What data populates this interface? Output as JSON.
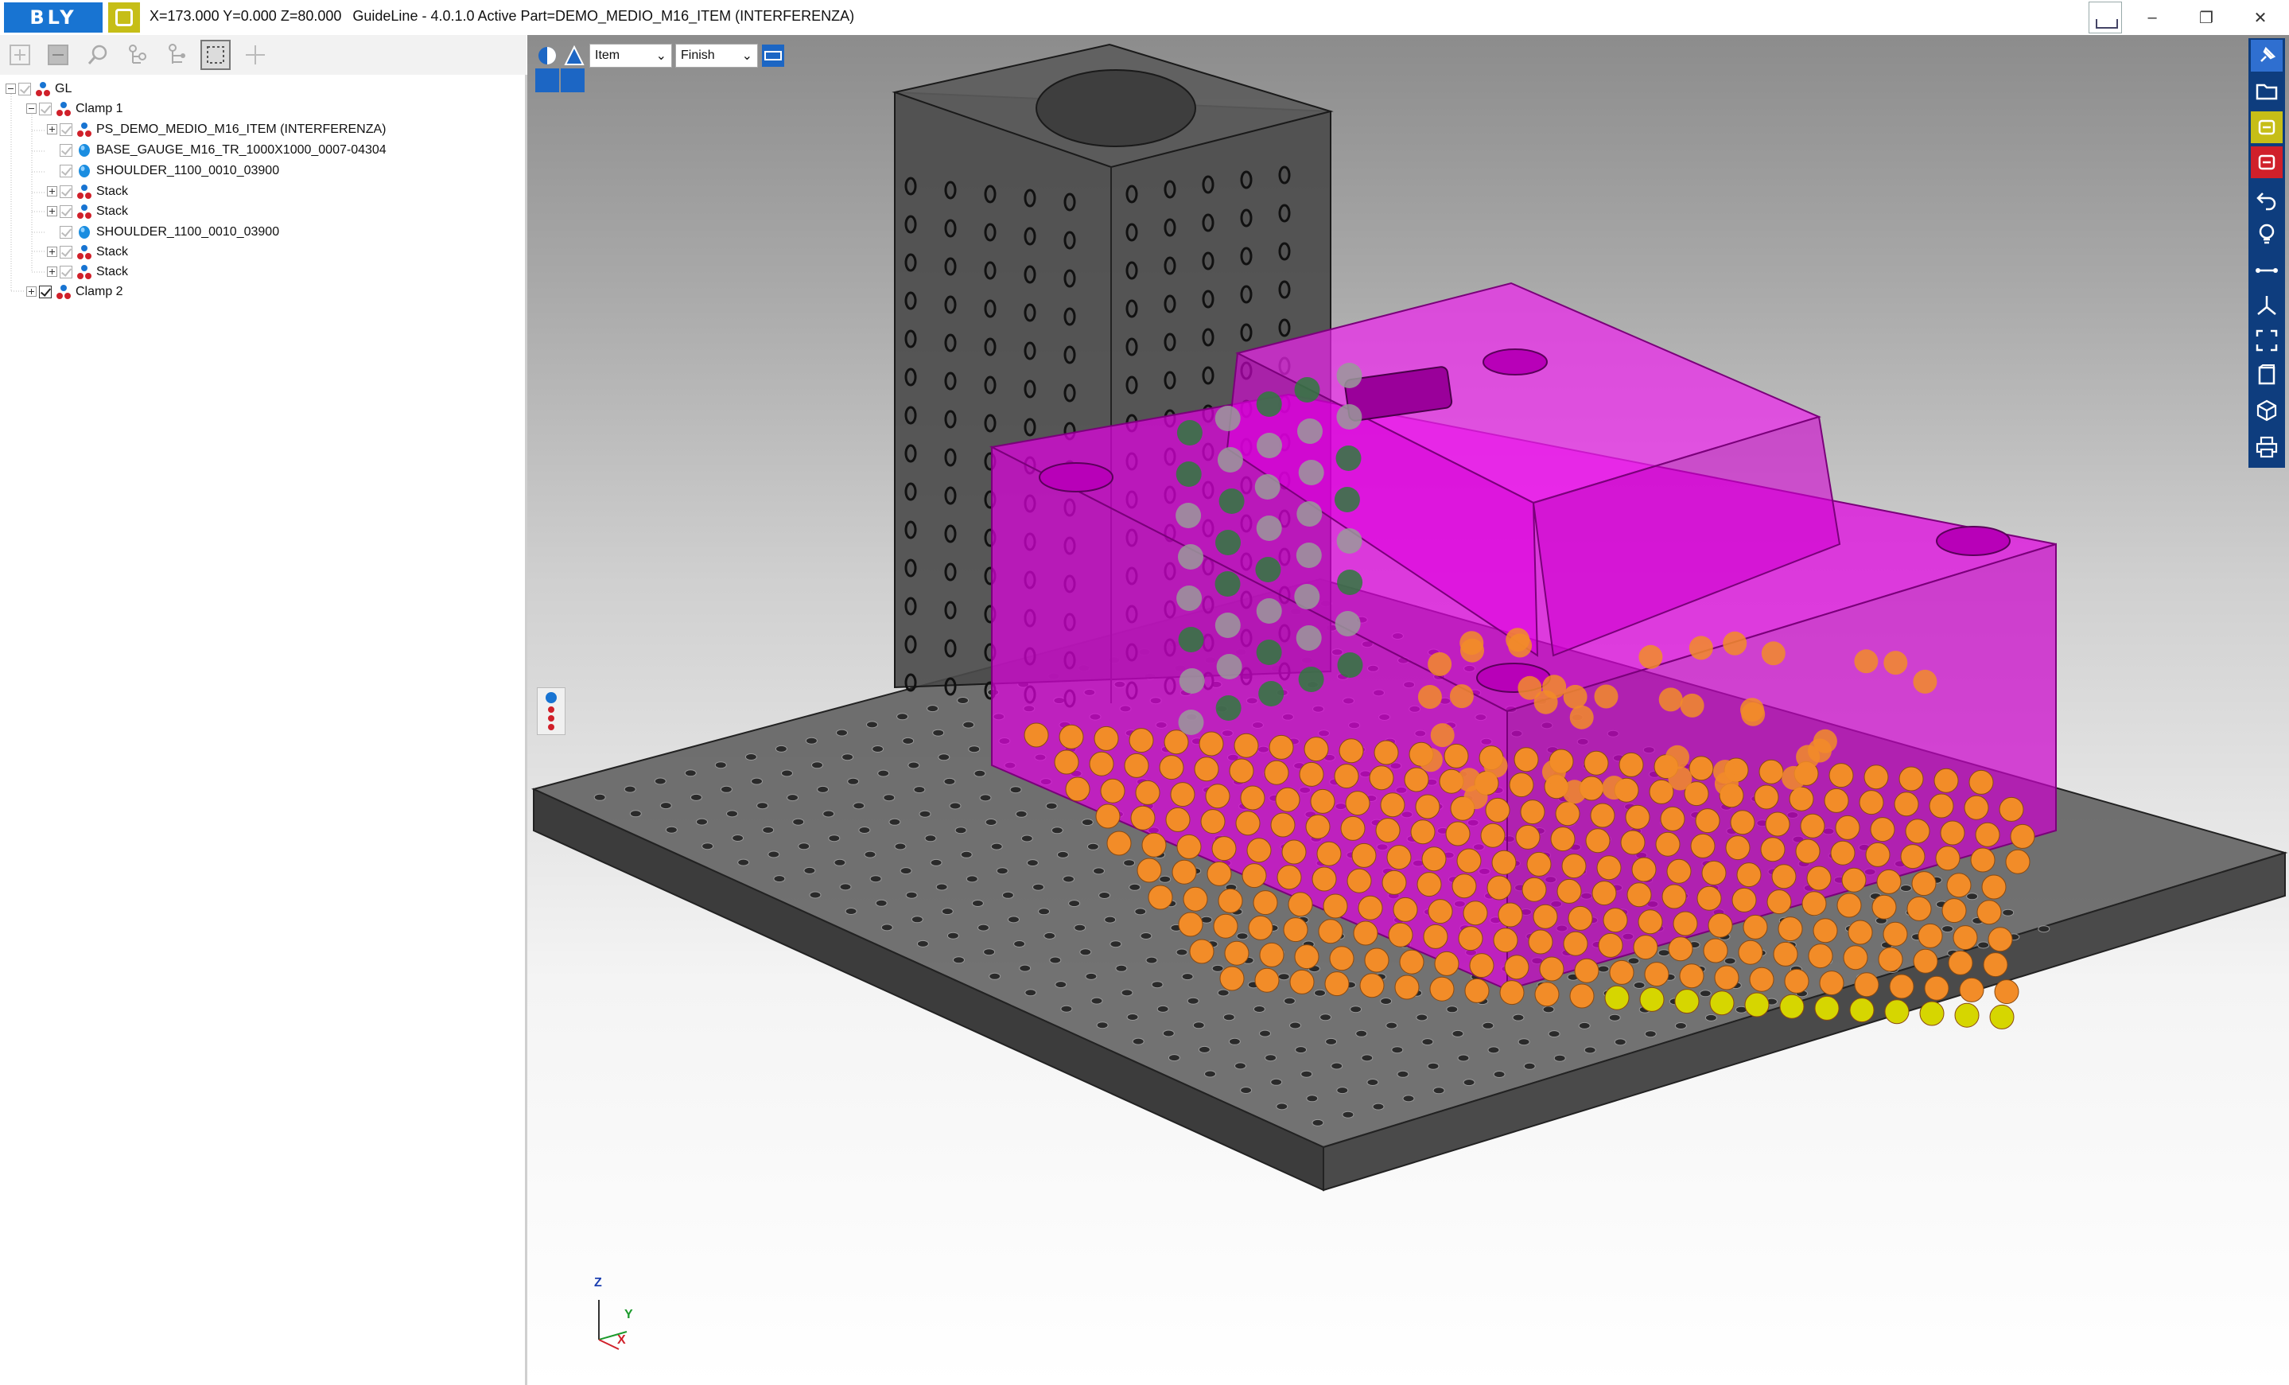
{
  "titlebar": {
    "logo_text": "BLY",
    "coords": "X=173.000 Y=0.000 Z=80.000",
    "app_info": "GuideLine - 4.0.1.0 Active Part=DEMO_MEDIO_M16_ITEM (INTERFERENZA)",
    "minimize_glyph": "–",
    "restore_glyph": "❐",
    "close_glyph": "✕"
  },
  "tree": {
    "items": [
      {
        "label": "GL"
      },
      {
        "label": "Clamp 1"
      },
      {
        "label": "PS_DEMO_MEDIO_M16_ITEM (INTERFERENZA)"
      },
      {
        "label": "BASE_GAUGE_M16_TR_1000X1000_0007-04304"
      },
      {
        "label": "SHOULDER_1100_0010_03900"
      },
      {
        "label": "Stack"
      },
      {
        "label": "Stack"
      },
      {
        "label": "SHOULDER_1100_0010_03900"
      },
      {
        "label": "Stack"
      },
      {
        "label": "Stack"
      },
      {
        "label": "Clamp 2"
      }
    ]
  },
  "viewport": {
    "mode_select": "Item",
    "finish_select": "Finish",
    "axes": {
      "z": "Z",
      "y": "Y",
      "x": "X"
    }
  },
  "colors": {
    "brand_blue": "#1874d2",
    "brand_yellow": "#c6be17",
    "toolbar_blue": "#0e3d7e",
    "part_magenta": "#e000e0",
    "ball_orange": "#f28c28",
    "ball_green": "#2f7a3d",
    "ball_yellow": "#d6d600"
  }
}
